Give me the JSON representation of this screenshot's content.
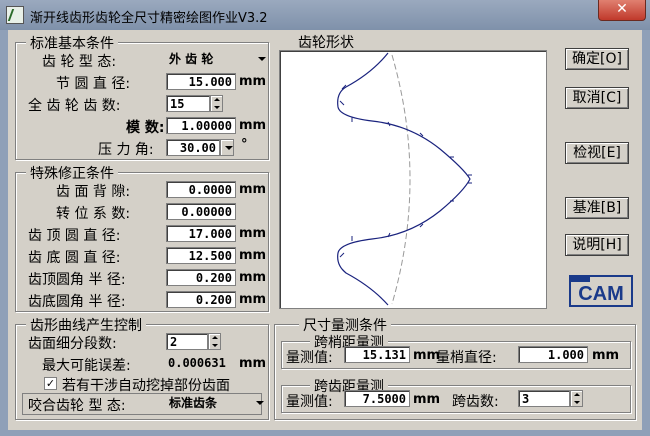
{
  "window": {
    "title": "渐开线齿形齿轮全尺寸精密绘图作业V3.2",
    "close_glyph": "✕"
  },
  "basic": {
    "legend": "标准基本条件",
    "rows": [
      {
        "label": "齿 轮 型 态:",
        "value": "外 齿 轮",
        "unit": ""
      },
      {
        "label": "节 圆 直 径:",
        "value": "15.000",
        "unit": "mm"
      },
      {
        "label": "全 齿 轮 齿 数:",
        "value": "15",
        "unit": ""
      },
      {
        "label": "模 数:",
        "value": "1.00000",
        "unit": "mm"
      },
      {
        "label": "压 力 角:",
        "value": "30.00",
        "unit": "°"
      }
    ]
  },
  "special": {
    "legend": "特殊修正条件",
    "rows": [
      {
        "label": "齿 面 背 隙:",
        "value": "0.0000",
        "unit": "mm"
      },
      {
        "label": "转 位 系 数:",
        "value": "0.00000",
        "unit": ""
      },
      {
        "label": "齿 顶 圆 直 径:",
        "value": "17.000",
        "unit": "mm"
      },
      {
        "label": "齿 底 圆 直 径:",
        "value": "12.500",
        "unit": "mm"
      },
      {
        "label": "齿顶圆角 半 径:",
        "value": "0.200",
        "unit": "mm"
      },
      {
        "label": "齿底圆角 半 径:",
        "value": "0.200",
        "unit": "mm"
      }
    ]
  },
  "curve": {
    "legend": "齿形曲线产生控制",
    "segments_label": "齿面细分段数:",
    "segments_value": "2",
    "max_error_label": "最大可能误差:",
    "max_error_value": "0.000631",
    "max_error_unit": "mm",
    "checkbox_label": "若有干涉自动挖掉部份齿面",
    "checkbox_checked": "✓",
    "mating_label": "咬合齿轮 型 态:",
    "mating_value": "标准齿条"
  },
  "shape": {
    "legend": "齿轮形状"
  },
  "measure": {
    "legend": "尺寸量测条件",
    "pin": {
      "title": "跨梢距量测",
      "value_label": "量测值:",
      "value": "15.131",
      "unit1": "mm",
      "dia_label": "量梢直径:",
      "dia_value": "1.000",
      "unit2": "mm"
    },
    "span": {
      "title": "跨齿距量测",
      "value_label": "量测值:",
      "value": "7.5000",
      "unit1": "mm",
      "teeth_label": "跨齿数:",
      "teeth_value": "3"
    }
  },
  "buttons": {
    "ok": "确定[O]",
    "cancel": "取消[C]",
    "view": "检视[E]",
    "datum": "基准[B]",
    "help": "说明[H]"
  },
  "logo": {
    "text": "CAM"
  }
}
